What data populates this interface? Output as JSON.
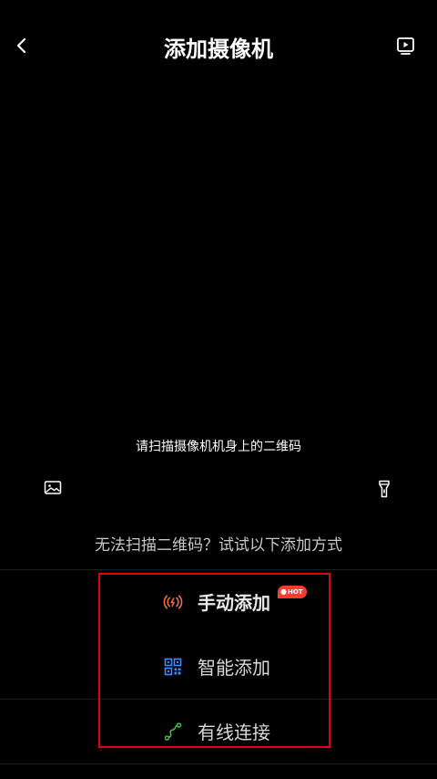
{
  "header": {
    "title": "添加摄像机",
    "back_icon": "chevron-left-icon",
    "video_icon": "play-video-icon"
  },
  "scanner": {
    "hint": "请扫描摄像机机身上的二维码",
    "album_icon": "image-icon",
    "flash_icon": "flashlight-icon"
  },
  "alternatives": {
    "prompt": "无法扫描二维码？试试以下添加方式",
    "options": [
      {
        "label": "手动添加",
        "icon": "wireless-signal-icon",
        "badge": "HOT",
        "icon_color": "#f06a4a"
      },
      {
        "label": "智能添加",
        "icon": "qr-code-icon",
        "icon_color": "#3d8bff"
      },
      {
        "label": "有线连接",
        "icon": "cable-icon",
        "icon_color": "#3fbf4a"
      }
    ]
  },
  "colors": {
    "background": "#000000",
    "highlight": "#e00012",
    "hot_badge": "#ff3b30"
  }
}
